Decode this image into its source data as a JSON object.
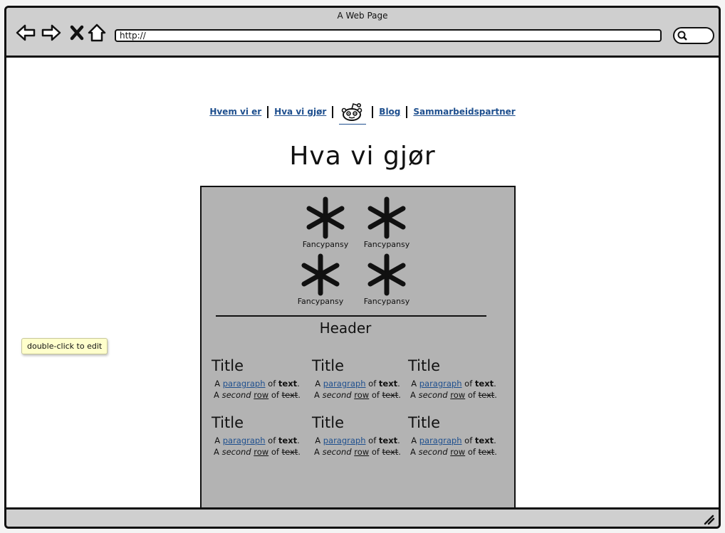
{
  "window": {
    "title": "A Web Page"
  },
  "address_bar": {
    "url": "http://"
  },
  "nav": {
    "items": [
      "Hvem vi er",
      "Hva vi gjør",
      "Blog",
      "Sammarbeidspartner"
    ]
  },
  "page": {
    "title": "Hva vi gjør"
  },
  "features": {
    "items": [
      "Fancypansy",
      "Fancypansy",
      "Fancypansy",
      "Fancypansy"
    ]
  },
  "section": {
    "header": "Header"
  },
  "grid": {
    "cells": [
      {
        "title": "Title"
      },
      {
        "title": "Title"
      },
      {
        "title": "Title"
      },
      {
        "title": "Title"
      },
      {
        "title": "Title"
      },
      {
        "title": "Title"
      }
    ],
    "text": {
      "a": "A",
      "paragraph": "paragraph",
      "of": "of",
      "text": "text",
      "period": ".",
      "second": "second",
      "row": "row"
    }
  },
  "tooltip": {
    "text": "double-click to edit"
  }
}
